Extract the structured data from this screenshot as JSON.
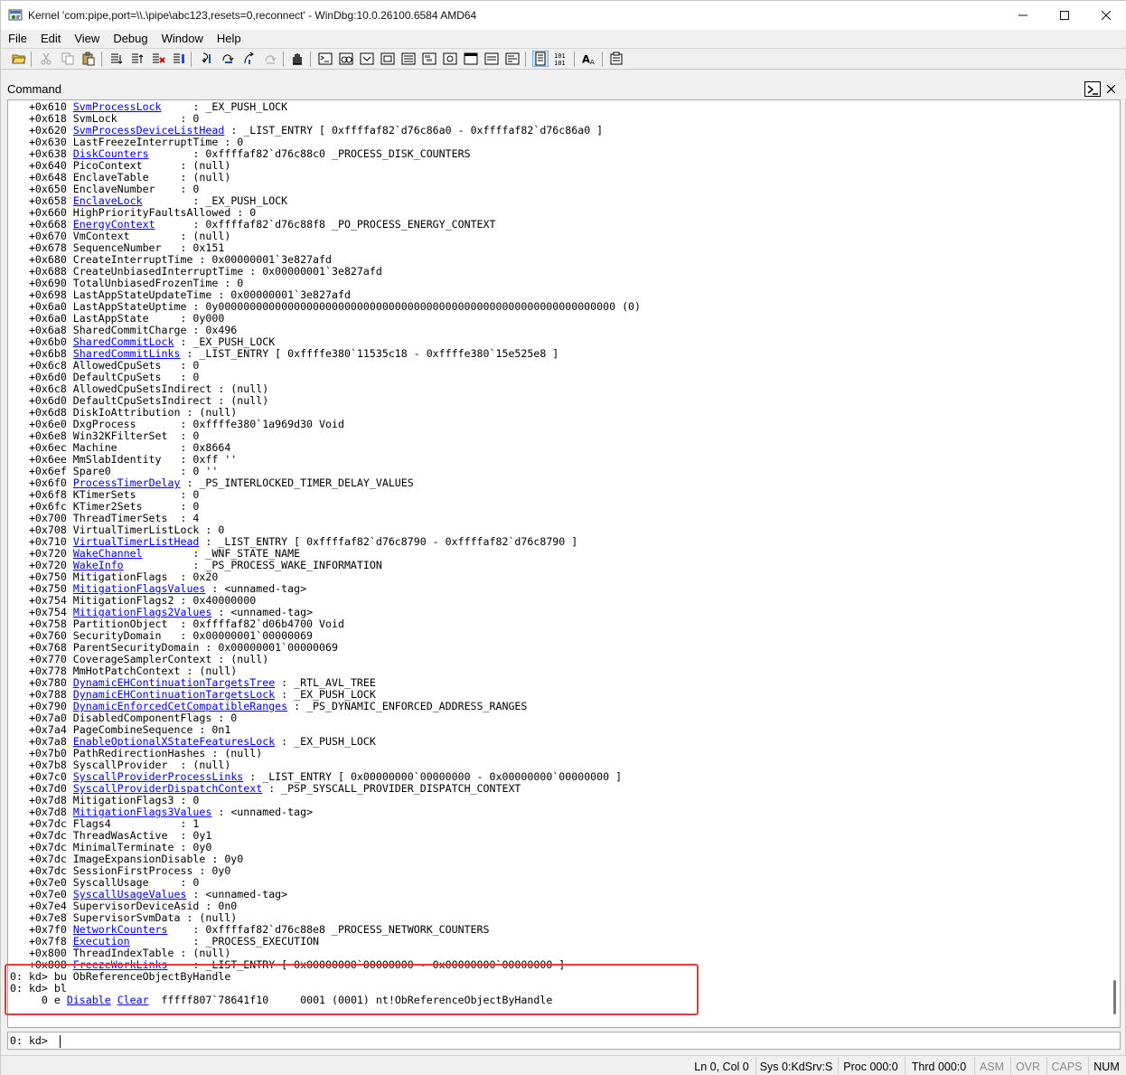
{
  "window": {
    "title": "Kernel 'com:pipe,port=\\\\.\\pipe\\abc123,resets=0,reconnect' - WinDbg:10.0.26100.6584 AMD64",
    "app_icon": "windbg-app-icon",
    "controls": {
      "minimize": "minimize-icon",
      "maximize": "maximize-icon",
      "close": "close-icon"
    }
  },
  "menu": {
    "items": [
      "File",
      "Edit",
      "View",
      "Debug",
      "Window",
      "Help"
    ]
  },
  "toolbar": {
    "icons": [
      "open-icon",
      "cut-icon",
      "copy-icon",
      "paste-icon",
      "go-icon",
      "restart-icon",
      "stop-debugging-icon",
      "break-icon",
      "step-into-icon",
      "step-over-icon",
      "step-out-icon",
      "run-to-cursor-icon",
      "insert-breakpoint-icon",
      "command-window-icon",
      "watch-window-icon",
      "locals-window-icon",
      "registers-window-icon",
      "memory-window-icon",
      "call-stack-icon",
      "disassembly-icon",
      "scratch-pad-icon",
      "processes-threads-icon",
      "source-mode-icon",
      "hex-display-icon",
      "font-icon",
      "options-icon"
    ]
  },
  "command_window": {
    "label": "Command",
    "output_lines": [
      [
        {
          "t": "   +0x610 "
        },
        {
          "t": "SvmProcessLock",
          "link": true
        },
        {
          "t": "     : _EX_PUSH_LOCK"
        }
      ],
      [
        {
          "t": "   +0x618 SvmLock          : 0"
        }
      ],
      [
        {
          "t": "   +0x620 "
        },
        {
          "t": "SvmProcessDeviceListHead",
          "link": true
        },
        {
          "t": " : _LIST_ENTRY [ 0xffffaf82`d76c86a0 - 0xffffaf82`d76c86a0 ]"
        }
      ],
      [
        {
          "t": "   +0x630 LastFreezeInterruptTime : 0"
        }
      ],
      [
        {
          "t": "   +0x638 "
        },
        {
          "t": "DiskCounters",
          "link": true
        },
        {
          "t": "       : 0xffffaf82`d76c88c0 _PROCESS_DISK_COUNTERS"
        }
      ],
      [
        {
          "t": "   +0x640 PicoContext      : (null)"
        }
      ],
      [
        {
          "t": "   +0x648 EnclaveTable     : (null)"
        }
      ],
      [
        {
          "t": "   +0x650 EnclaveNumber    : 0"
        }
      ],
      [
        {
          "t": "   +0x658 "
        },
        {
          "t": "EnclaveLock",
          "link": true
        },
        {
          "t": "        : _EX_PUSH_LOCK"
        }
      ],
      [
        {
          "t": "   +0x660 HighPriorityFaultsAllowed : 0"
        }
      ],
      [
        {
          "t": "   +0x668 "
        },
        {
          "t": "EnergyContext",
          "link": true
        },
        {
          "t": "      : 0xffffaf82`d76c88f8 _PO_PROCESS_ENERGY_CONTEXT"
        }
      ],
      [
        {
          "t": "   +0x670 VmContext        : (null)"
        }
      ],
      [
        {
          "t": "   +0x678 SequenceNumber   : 0x151"
        }
      ],
      [
        {
          "t": "   +0x680 CreateInterruptTime : 0x00000001`3e827afd"
        }
      ],
      [
        {
          "t": "   +0x688 CreateUnbiasedInterruptTime : 0x00000001`3e827afd"
        }
      ],
      [
        {
          "t": "   +0x690 TotalUnbiasedFrozenTime : 0"
        }
      ],
      [
        {
          "t": "   +0x698 LastAppStateUpdateTime : 0x00000001`3e827afd"
        }
      ],
      [
        {
          "t": "   +0x6a0 LastAppStateUptime : 0y000000000000000000000000000000000000000000000000000000000000000 (0)"
        }
      ],
      [
        {
          "t": "   +0x6a0 LastAppState     : 0y000"
        }
      ],
      [
        {
          "t": "   +0x6a8 SharedCommitCharge : 0x496"
        }
      ],
      [
        {
          "t": "   +0x6b0 "
        },
        {
          "t": "SharedCommitLock",
          "link": true
        },
        {
          "t": " : _EX_PUSH_LOCK"
        }
      ],
      [
        {
          "t": "   +0x6b8 "
        },
        {
          "t": "SharedCommitLinks",
          "link": true
        },
        {
          "t": " : _LIST_ENTRY [ 0xffffe380`11535c18 - 0xffffe380`15e525e8 ]"
        }
      ],
      [
        {
          "t": "   +0x6c8 AllowedCpuSets   : 0"
        }
      ],
      [
        {
          "t": "   +0x6d0 DefaultCpuSets   : 0"
        }
      ],
      [
        {
          "t": "   +0x6c8 AllowedCpuSetsIndirect : (null)"
        }
      ],
      [
        {
          "t": "   +0x6d0 DefaultCpuSetsIndirect : (null)"
        }
      ],
      [
        {
          "t": "   +0x6d8 DiskIoAttribution : (null)"
        }
      ],
      [
        {
          "t": "   +0x6e0 DxgProcess       : 0xffffe380`1a969d30 Void"
        }
      ],
      [
        {
          "t": "   +0x6e8 Win32KFilterSet  : 0"
        }
      ],
      [
        {
          "t": "   +0x6ec Machine          : 0x8664"
        }
      ],
      [
        {
          "t": "   +0x6ee MmSlabIdentity   : 0xff ''"
        }
      ],
      [
        {
          "t": "   +0x6ef Spare0           : 0 ''"
        }
      ],
      [
        {
          "t": "   +0x6f0 "
        },
        {
          "t": "ProcessTimerDelay",
          "link": true
        },
        {
          "t": " : _PS_INTERLOCKED_TIMER_DELAY_VALUES"
        }
      ],
      [
        {
          "t": "   +0x6f8 KTimerSets       : 0"
        }
      ],
      [
        {
          "t": "   +0x6fc KTimer2Sets      : 0"
        }
      ],
      [
        {
          "t": "   +0x700 ThreadTimerSets  : 4"
        }
      ],
      [
        {
          "t": "   +0x708 VirtualTimerListLock : 0"
        }
      ],
      [
        {
          "t": "   +0x710 "
        },
        {
          "t": "VirtualTimerListHead",
          "link": true
        },
        {
          "t": " : _LIST_ENTRY [ 0xffffaf82`d76c8790 - 0xffffaf82`d76c8790 ]"
        }
      ],
      [
        {
          "t": "   +0x720 "
        },
        {
          "t": "WakeChannel",
          "link": true
        },
        {
          "t": "        : _WNF_STATE_NAME"
        }
      ],
      [
        {
          "t": "   +0x720 "
        },
        {
          "t": "WakeInfo",
          "link": true
        },
        {
          "t": "           : _PS_PROCESS_WAKE_INFORMATION"
        }
      ],
      [
        {
          "t": "   +0x750 MitigationFlags  : 0x20"
        }
      ],
      [
        {
          "t": "   +0x750 "
        },
        {
          "t": "MitigationFlagsValues",
          "link": true
        },
        {
          "t": " : <unnamed-tag>"
        }
      ],
      [
        {
          "t": "   +0x754 MitigationFlags2 : 0x40000000"
        }
      ],
      [
        {
          "t": "   +0x754 "
        },
        {
          "t": "MitigationFlags2Values",
          "link": true
        },
        {
          "t": " : <unnamed-tag>"
        }
      ],
      [
        {
          "t": "   +0x758 PartitionObject  : 0xffffaf82`d06b4700 Void"
        }
      ],
      [
        {
          "t": "   +0x760 SecurityDomain   : 0x00000001`00000069"
        }
      ],
      [
        {
          "t": "   +0x768 ParentSecurityDomain : 0x00000001`00000069"
        }
      ],
      [
        {
          "t": "   +0x770 CoverageSamplerContext : (null)"
        }
      ],
      [
        {
          "t": "   +0x778 MmHotPatchContext : (null)"
        }
      ],
      [
        {
          "t": "   +0x780 "
        },
        {
          "t": "DynamicEHContinuationTargetsTree",
          "link": true
        },
        {
          "t": " : _RTL_AVL_TREE"
        }
      ],
      [
        {
          "t": "   +0x788 "
        },
        {
          "t": "DynamicEHContinuationTargetsLock",
          "link": true
        },
        {
          "t": " : _EX_PUSH_LOCK"
        }
      ],
      [
        {
          "t": "   +0x790 "
        },
        {
          "t": "DynamicEnforcedCetCompatibleRanges",
          "link": true
        },
        {
          "t": " : _PS_DYNAMIC_ENFORCED_ADDRESS_RANGES"
        }
      ],
      [
        {
          "t": "   +0x7a0 DisabledComponentFlags : 0"
        }
      ],
      [
        {
          "t": "   +0x7a4 PageCombineSequence : 0n1"
        }
      ],
      [
        {
          "t": "   +0x7a8 "
        },
        {
          "t": "EnableOptionalXStateFeaturesLock",
          "link": true
        },
        {
          "t": " : _EX_PUSH_LOCK"
        }
      ],
      [
        {
          "t": "   +0x7b0 PathRedirectionHashes : (null)"
        }
      ],
      [
        {
          "t": "   +0x7b8 SyscallProvider  : (null)"
        }
      ],
      [
        {
          "t": "   +0x7c0 "
        },
        {
          "t": "SyscallProviderProcessLinks",
          "link": true
        },
        {
          "t": " : _LIST_ENTRY [ 0x00000000`00000000 - 0x00000000`00000000 ]"
        }
      ],
      [
        {
          "t": "   +0x7d0 "
        },
        {
          "t": "SyscallProviderDispatchContext",
          "link": true
        },
        {
          "t": " : _PSP_SYSCALL_PROVIDER_DISPATCH_CONTEXT"
        }
      ],
      [
        {
          "t": "   +0x7d8 MitigationFlags3 : 0"
        }
      ],
      [
        {
          "t": "   +0x7d8 "
        },
        {
          "t": "MitigationFlags3Values",
          "link": true
        },
        {
          "t": " : <unnamed-tag>"
        }
      ],
      [
        {
          "t": "   +0x7dc Flags4           : 1"
        }
      ],
      [
        {
          "t": "   +0x7dc ThreadWasActive  : 0y1"
        }
      ],
      [
        {
          "t": "   +0x7dc MinimalTerminate : 0y0"
        }
      ],
      [
        {
          "t": "   +0x7dc ImageExpansionDisable : 0y0"
        }
      ],
      [
        {
          "t": "   +0x7dc SessionFirstProcess : 0y0"
        }
      ],
      [
        {
          "t": "   +0x7e0 SyscallUsage     : 0"
        }
      ],
      [
        {
          "t": "   +0x7e0 "
        },
        {
          "t": "SyscallUsageValues",
          "link": true
        },
        {
          "t": " : <unnamed-tag>"
        }
      ],
      [
        {
          "t": "   +0x7e4 SupervisorDeviceAsid : 0n0"
        }
      ],
      [
        {
          "t": "   +0x7e8 SupervisorSvmData : (null)"
        }
      ],
      [
        {
          "t": "   +0x7f0 "
        },
        {
          "t": "NetworkCounters",
          "link": true
        },
        {
          "t": "    : 0xffffaf82`d76c88e8 _PROCESS_NETWORK_COUNTERS"
        }
      ],
      [
        {
          "t": "   +0x7f8 "
        },
        {
          "t": "Execution",
          "link": true
        },
        {
          "t": "          : _PROCESS_EXECUTION"
        }
      ],
      [
        {
          "t": "   +0x800 ThreadIndexTable : (null)"
        }
      ],
      [
        {
          "t": "   +0x808 "
        },
        {
          "t": "FreezeWorkLinks",
          "link": true
        },
        {
          "t": "    : _LIST_ENTRY [ 0x00000000`00000000 - 0x00000000`00000000 ]"
        }
      ],
      [
        {
          "t": "0: kd> bu ObReferenceObjectByHandle"
        }
      ],
      [
        {
          "t": "0: kd> bl"
        }
      ],
      [
        {
          "t": "     0 e "
        },
        {
          "t": "Disable",
          "link": true
        },
        {
          "t": " "
        },
        {
          "t": "Clear",
          "link": true
        },
        {
          "t": "  fffff807`78641f10     0001 (0001) nt!ObReferenceObjectByHandle"
        }
      ]
    ],
    "prompt": "0: kd> ",
    "input_value": ""
  },
  "statusbar": {
    "fields": [
      {
        "text": "Ln 0, Col 0",
        "dim": false
      },
      {
        "text": "Sys 0:KdSrv:S",
        "dim": false
      },
      {
        "text": "Proc 000:0",
        "dim": false
      },
      {
        "text": "Thrd 000:0",
        "dim": false
      },
      {
        "text": "ASM",
        "dim": true
      },
      {
        "text": "OVR",
        "dim": true
      },
      {
        "text": "CAPS",
        "dim": true
      },
      {
        "text": "NUM",
        "dim": false
      }
    ]
  },
  "colors": {
    "link": "#0000ee",
    "highlight": "#e23b3b",
    "window_bg": "#f0f0f0",
    "output_bg": "#ffffff"
  }
}
